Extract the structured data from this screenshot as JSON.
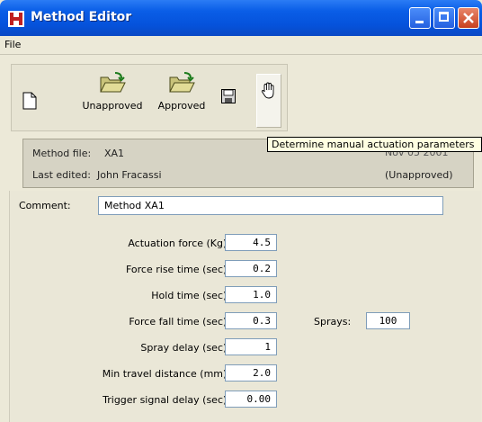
{
  "window": {
    "title": "Method Editor"
  },
  "menu": {
    "file_label": "File"
  },
  "toolbar": {
    "new_icon": "new-document-icon",
    "unapproved_label": "Unapproved",
    "approved_label": "Approved",
    "save_icon": "floppy-disk-icon",
    "hand_icon": "hand-icon"
  },
  "tooltip": {
    "text": "Determine manual actuation parameters"
  },
  "info": {
    "method_file_label": "Method file:",
    "method_file_value": "XA1",
    "date_partial": "Nov 05 2001",
    "last_edited_label": "Last edited:",
    "last_edited_value": "John Fracassi",
    "status": "(Unapproved)"
  },
  "comment": {
    "label": "Comment:",
    "value": "Method XA1"
  },
  "params": [
    {
      "label": "Actuation force (Kg):",
      "value": "4.5"
    },
    {
      "label": "Force rise time (sec):",
      "value": "0.2"
    },
    {
      "label": "Hold time (sec):",
      "value": "1.0"
    },
    {
      "label": "Force fall time (sec):",
      "value": "0.3"
    },
    {
      "label": "Spray delay (sec):",
      "value": "1"
    },
    {
      "label": "Min travel distance (mm):",
      "value": "2.0"
    },
    {
      "label": "Trigger signal delay (sec):",
      "value": "0.00"
    }
  ],
  "sprays": {
    "label": "Sprays:",
    "value": "100"
  },
  "colors": {
    "titlebar": "#0552db",
    "close_button": "#c8401e",
    "window_bg": "#ece9d8",
    "tooltip_bg": "#ffffe1"
  }
}
